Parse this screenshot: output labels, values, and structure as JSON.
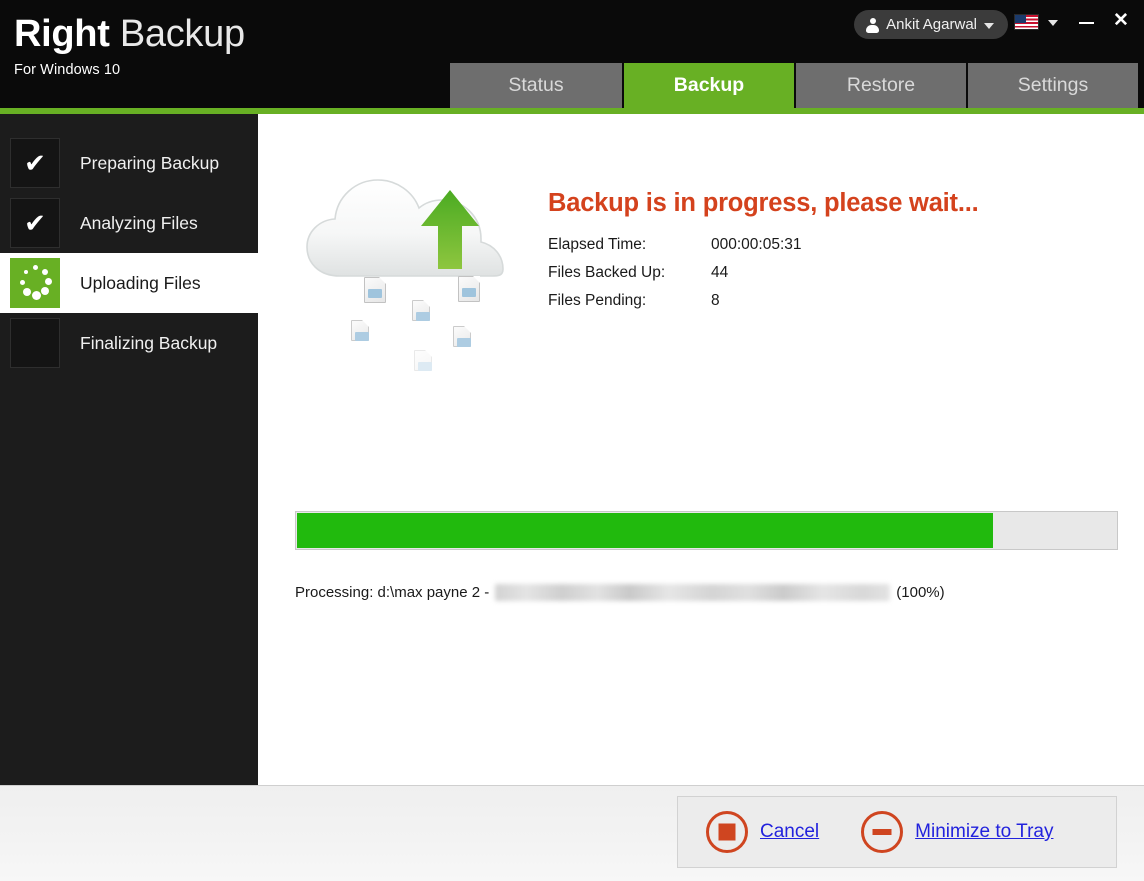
{
  "titlebar": {
    "brand_bold": "Right",
    "brand_light": " Backup",
    "subtitle": "For Windows 10",
    "account": {
      "name": "Ankit Agarwal",
      "person_icon": "person-icon",
      "caret_icon": "chevron-down-icon"
    },
    "language": {
      "flag": "us-flag-icon",
      "caret_icon": "chevron-down-icon"
    },
    "window_controls": {
      "minimize": "minimize-icon",
      "minimize_glyph": "",
      "close": "close-icon",
      "close_glyph": "✕"
    }
  },
  "tabs": [
    {
      "label": "Status",
      "active": false
    },
    {
      "label": "Backup",
      "active": true
    },
    {
      "label": "Restore",
      "active": false
    },
    {
      "label": "Settings",
      "active": false
    }
  ],
  "sidebar": {
    "steps": [
      {
        "label": "Preparing Backup",
        "state": "done",
        "glyph": "✔"
      },
      {
        "label": "Analyzing Files",
        "state": "done",
        "glyph": "✔"
      },
      {
        "label": "Uploading Files",
        "state": "active",
        "glyph": ""
      },
      {
        "label": "Finalizing Backup",
        "state": "pending",
        "glyph": ""
      }
    ]
  },
  "main": {
    "illustration": "cloud-upload-icon",
    "heading": "Backup is in progress, please wait...",
    "stats": [
      {
        "key": "Elapsed Time:",
        "value": "000:00:05:31"
      },
      {
        "key": "Files Backed Up:",
        "value": "44"
      },
      {
        "key": "Files Pending:",
        "value": "8"
      }
    ],
    "progress": {
      "percent": 85,
      "fill_width": "85%"
    },
    "processing": {
      "prefix": "Processing: d:\\max payne 2 -",
      "redacted": "",
      "percent": "(100%)"
    }
  },
  "footer": {
    "actions": [
      {
        "label": "Cancel",
        "icon": "stop-icon"
      },
      {
        "label": "Minimize to Tray",
        "icon": "minimize-to-tray-icon"
      }
    ]
  },
  "colors": {
    "accent_green": "#68b024",
    "progress_green": "#21ba0d",
    "heading_red": "#d4421d",
    "link_blue": "#2222dd",
    "titlebar_black": "#0a0a0a",
    "sidebar_black": "#1c1c1c",
    "tab_gray": "#6e6e6e"
  }
}
